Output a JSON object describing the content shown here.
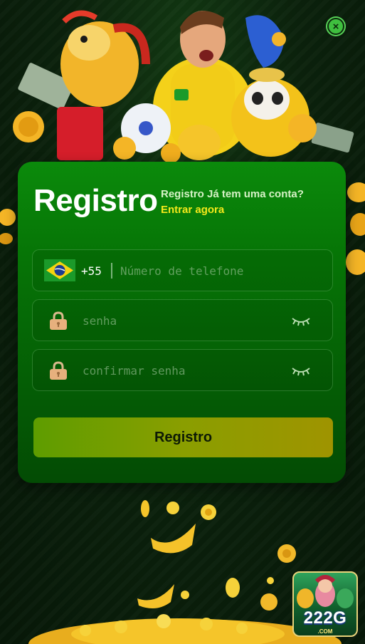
{
  "close_label": "×",
  "register": {
    "title": "Registro",
    "login_prompt_text": "Registro Já tem uma conta?",
    "login_link": "Entrar agora"
  },
  "phone": {
    "country_code": "+55",
    "placeholder": "Número de telefone",
    "flag_icon": "brazil-flag-icon"
  },
  "password": {
    "placeholder": "senha",
    "lock_icon": "lock-icon",
    "toggle_icon": "eye-closed-icon"
  },
  "confirm_password": {
    "placeholder": "confirmar senha",
    "lock_icon": "lock-icon",
    "toggle_icon": "eye-closed-icon"
  },
  "submit_label": "Registro",
  "brand": {
    "logo": "222G",
    "logo_sub": ".COM"
  },
  "colors": {
    "card_green": "#067406",
    "link_yellow": "#f5ea1a",
    "button_olive": "#8a9e00",
    "close_green": "#3fbf3f"
  }
}
